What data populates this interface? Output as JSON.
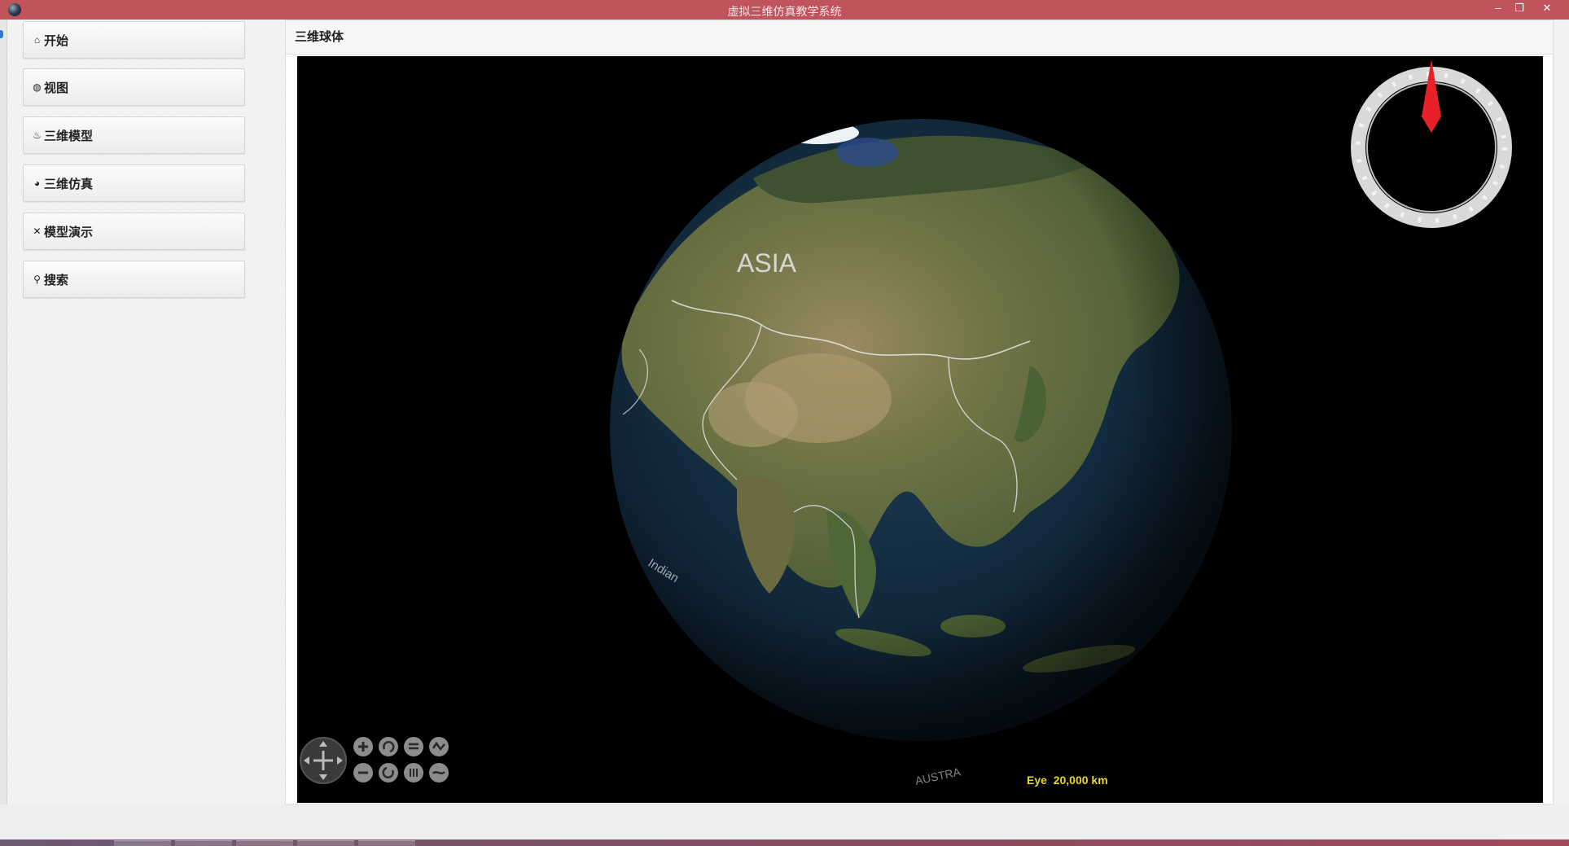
{
  "window": {
    "title": "虚拟三维仿真教学系统",
    "controls": {
      "minimize": "–",
      "restore": "❐",
      "close": "✕"
    }
  },
  "sidebar": {
    "items": [
      {
        "label": "开始",
        "icon": "home-icon",
        "glyph": "⌂"
      },
      {
        "label": "视图",
        "icon": "view-icon",
        "glyph": "◍"
      },
      {
        "label": "三维模型",
        "icon": "model-icon",
        "glyph": "♨"
      },
      {
        "label": "三维仿真",
        "icon": "globe-icon",
        "glyph": "◕"
      },
      {
        "label": "模型演示",
        "icon": "tools-icon",
        "glyph": "✕"
      },
      {
        "label": "搜索",
        "icon": "search-icon",
        "glyph": "⚲"
      }
    ]
  },
  "panel": {
    "title": "三维球体"
  },
  "map": {
    "continent_label": "ASIA",
    "ocean_label_left": "Indian",
    "ocean_label_bottom": "AUSTRA",
    "eye_label": "Eye",
    "eye_altitude": "20,000 km",
    "nav_controls": [
      "zoom-in",
      "rotate-left",
      "tilt-up",
      "pan-wave",
      "zoom-out",
      "rotate-right",
      "tilt-down",
      "reset-wave"
    ]
  },
  "colors": {
    "titlebar": "#c0535c",
    "compass_needle": "#e8202a",
    "eye_text": "#e9d62a"
  }
}
